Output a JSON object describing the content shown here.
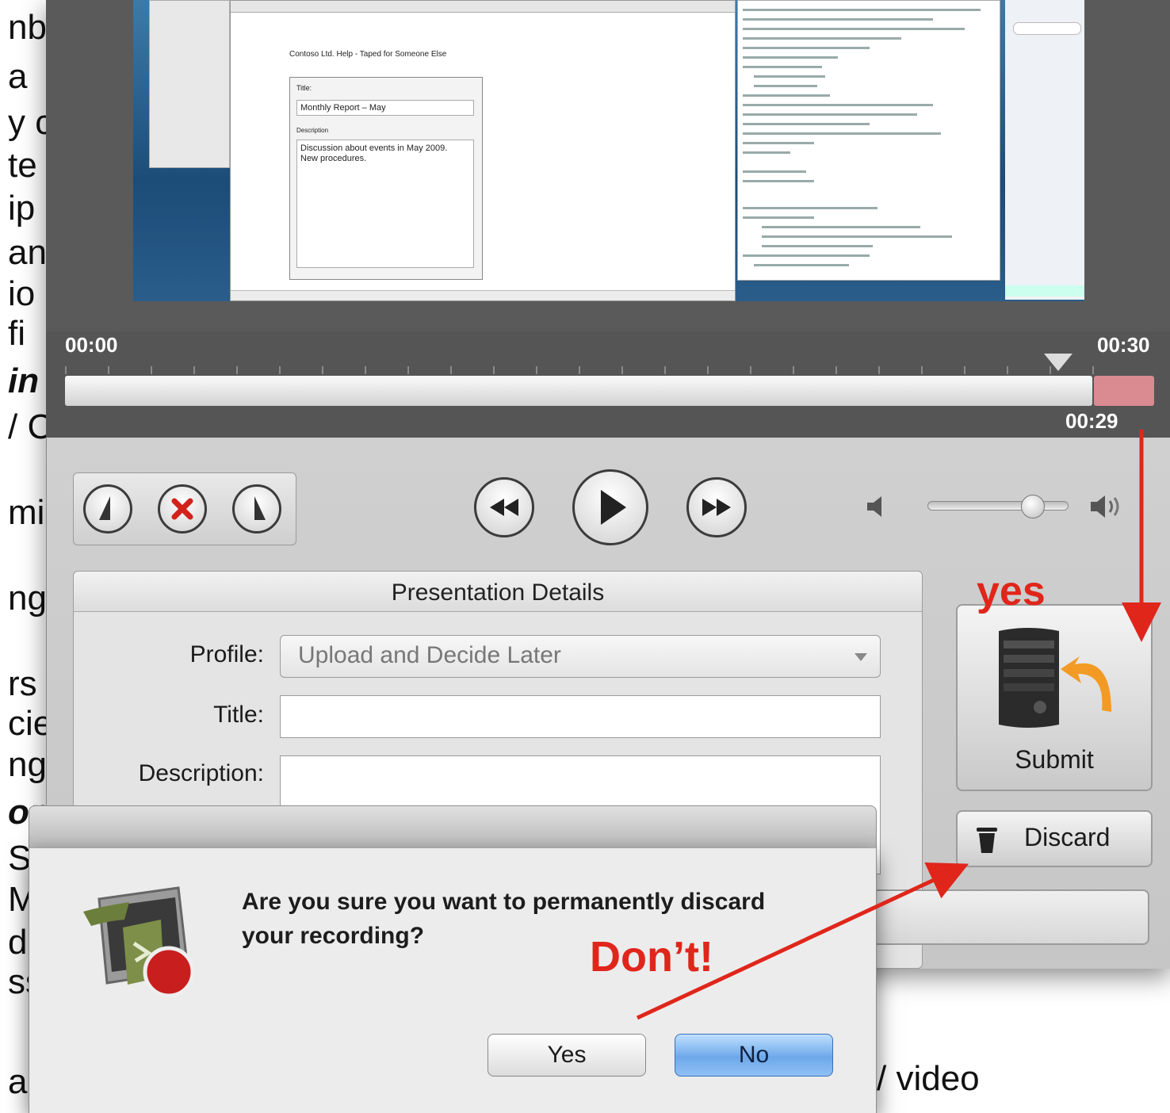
{
  "background_doc": {
    "left_fragments": [
      "nb",
      "a",
      "y c",
      "te",
      "ip",
      "an",
      "io",
      "fi",
      "in",
      "/ C",
      "mi",
      "ng",
      "rs",
      "cie",
      "ng",
      "or",
      "S",
      "M",
      "d",
      "ss",
      "ab"
    ],
    "bottom_right_text": "/ video"
  },
  "preview": {
    "doc_title": "Contoso Ltd. Help - Taped for Someone Else",
    "title_label": "Title:",
    "title_value": "Monthly Report – May",
    "description_label": "Description",
    "description_value": "Discussion about events in May 2009. New procedures."
  },
  "timeline": {
    "start_time": "00:00",
    "end_time": "00:30",
    "current_time": "00:29",
    "position_fraction": 0.967
  },
  "controls": {
    "volume_fraction": 0.75
  },
  "presentation_details": {
    "header": "Presentation Details",
    "profile_label": "Profile:",
    "profile_value": "Upload and Decide Later",
    "title_label": "Title:",
    "title_value": "",
    "description_label": "Description:",
    "description_value": ""
  },
  "side_buttons": {
    "submit_label": "Submit",
    "discard_label": "Discard"
  },
  "dialog": {
    "question": "Are you sure you want to permanently discard your recording?",
    "yes_label": "Yes",
    "no_label": "No"
  },
  "annotations": {
    "yes_note": "yes",
    "dont_note": "Don’t!",
    "color": "#e0261b"
  }
}
